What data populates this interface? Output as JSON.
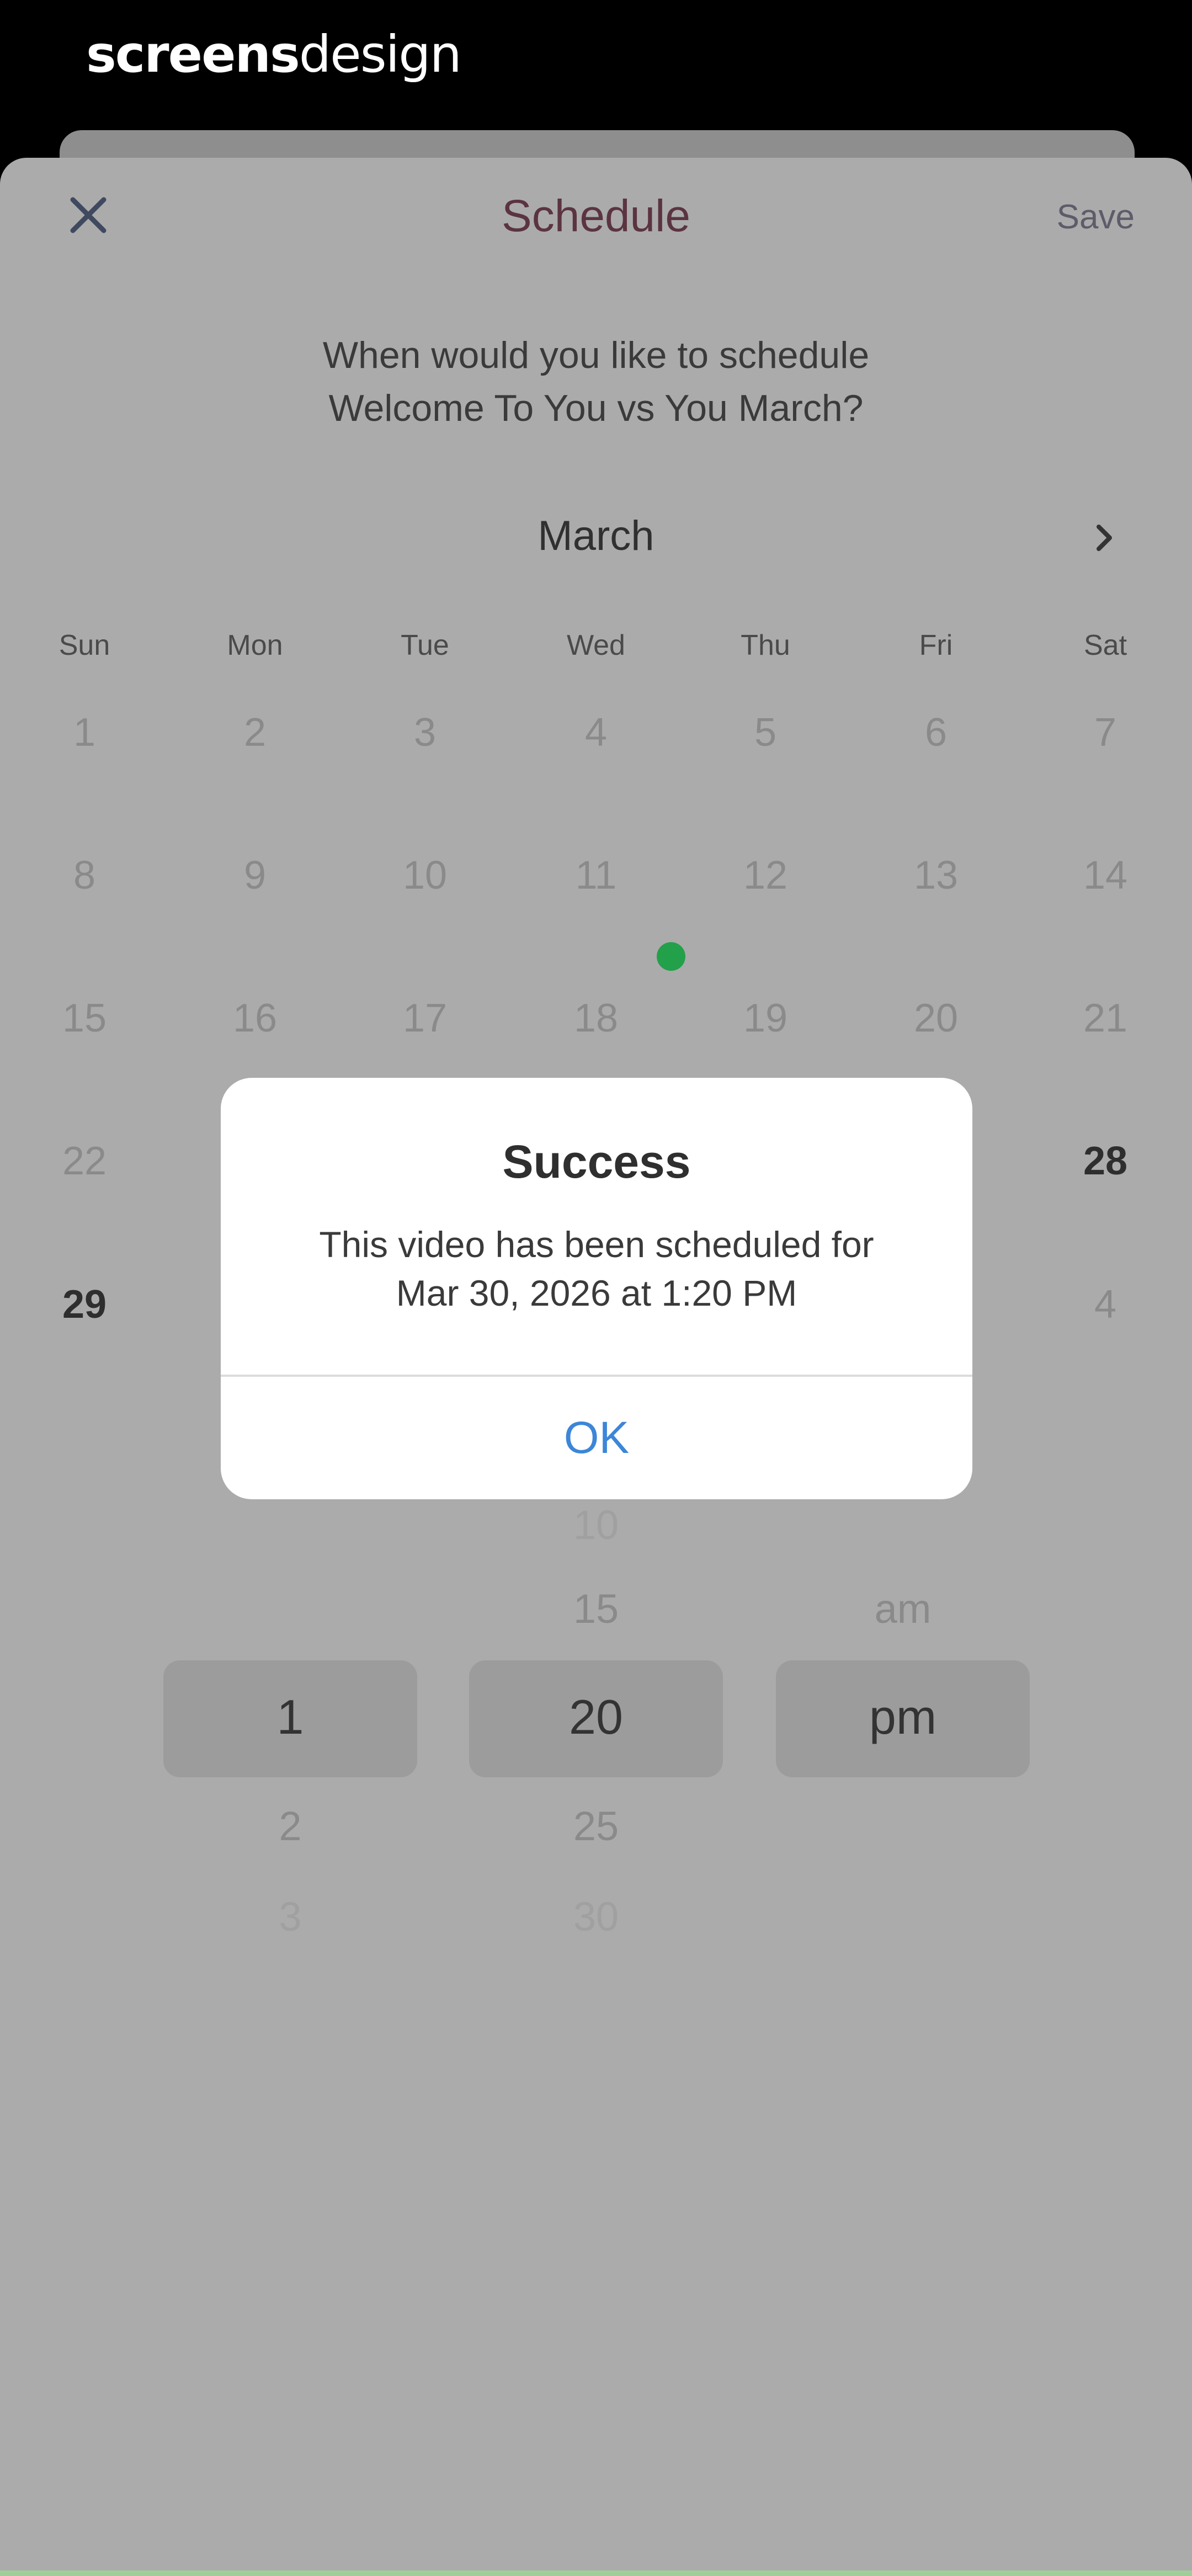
{
  "brand": {
    "part1": "screens",
    "part2": "design"
  },
  "nav": {
    "title": "Schedule",
    "save_label": "Save",
    "close_icon": "close-icon"
  },
  "prompt": {
    "line1": "When would you like to schedule",
    "line2": "Welcome To You vs You March?"
  },
  "calendar": {
    "month": "March",
    "next_icon": "chevron-right-icon",
    "weekdays": [
      "Sun",
      "Mon",
      "Tue",
      "Wed",
      "Thu",
      "Fri",
      "Sat"
    ],
    "rows": [
      [
        "1",
        "2",
        "3",
        "4",
        "5",
        "6",
        "7"
      ],
      [
        "8",
        "9",
        "10",
        "11",
        "12",
        "13",
        "14"
      ],
      [
        "15",
        "16",
        "17",
        "18",
        "19",
        "20",
        "21"
      ],
      [
        "22",
        "",
        "",
        "",
        "",
        "",
        "28"
      ],
      [
        "29",
        "",
        "",
        "",
        "",
        "",
        "4"
      ]
    ]
  },
  "time_picker": {
    "hours": {
      "above": "",
      "selected": "1",
      "below1": "2",
      "below2": "3"
    },
    "minutes": {
      "above2": "10",
      "above1": "15",
      "selected": "20",
      "below1": "25",
      "below2": "30"
    },
    "period": {
      "above": "am",
      "selected": "pm"
    }
  },
  "alert": {
    "title": "Success",
    "message_line1": "This video has been scheduled for",
    "message_line2": "Mar 30, 2026 at 1:20 PM",
    "ok_label": "OK"
  },
  "colors": {
    "accent_blue": "#3d86d8",
    "today_dot": "#23a04a",
    "title_color": "#5b3440"
  }
}
